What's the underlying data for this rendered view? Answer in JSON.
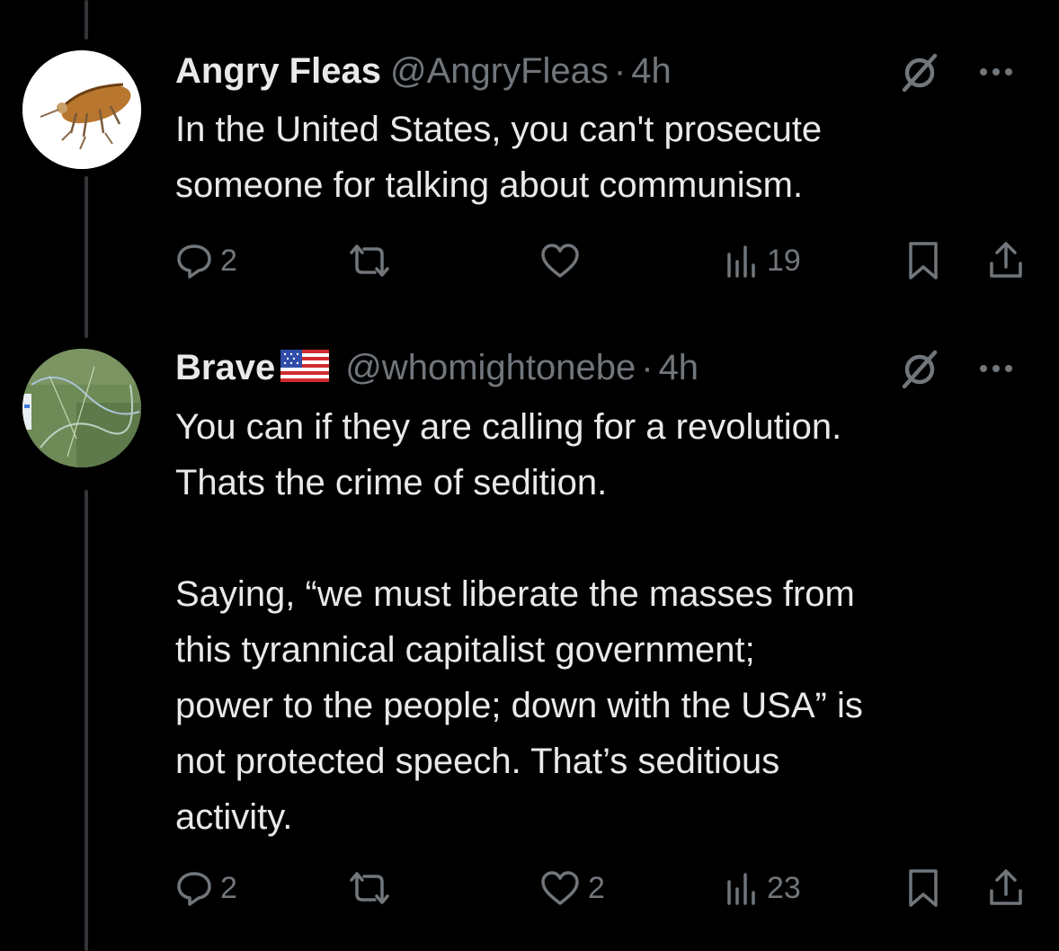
{
  "tweets": [
    {
      "display_name": "Angry Fleas",
      "handle": "@AngryFleas",
      "separator": "·",
      "time": "4h",
      "text": "In the United States, you can't prosecute\nsomeone for talking about communism.",
      "replies": "2",
      "reposts": "",
      "likes": "",
      "views": "19",
      "avatar_icon": "flea-avatar"
    },
    {
      "display_name": "Brave",
      "flag_icon": "us-flag-icon",
      "handle": "@whomightonebe",
      "separator": "·",
      "time": "4h",
      "text": "You can if they are calling for a revolution.\nThats the crime of sedition.\n\nSaying, “we must liberate the masses from\nthis tyrannical capitalist government;\npower to the people; down with the USA” is\nnot protected speech. That’s seditious\nactivity.",
      "replies": "2",
      "reposts": "",
      "likes": "2",
      "views": "23",
      "avatar_icon": "map-avatar"
    }
  ],
  "colors": {
    "background": "#000000",
    "text": "#e7e9ea",
    "muted": "#71767b",
    "thread_line": "#333639"
  }
}
